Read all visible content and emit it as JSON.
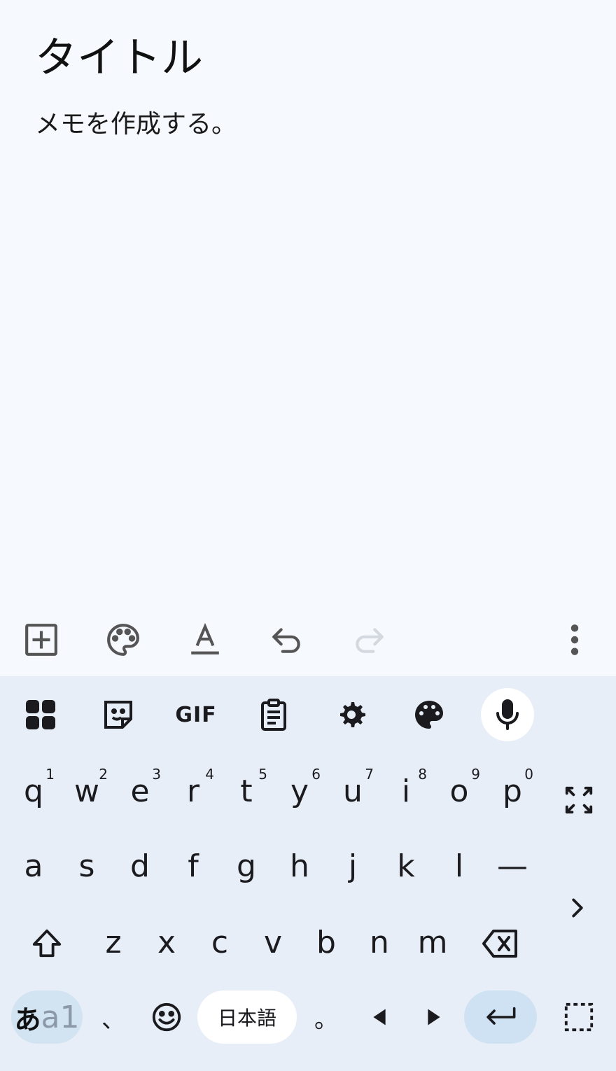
{
  "note": {
    "title": "タイトル",
    "body": "メモを作成する。"
  },
  "note_toolbar": {
    "icons": [
      "add-box-icon",
      "palette-icon",
      "text-format-icon",
      "undo-icon",
      "redo-icon",
      "more-vert-icon"
    ]
  },
  "keyboard": {
    "toolbar_icons": [
      "apps-grid-icon",
      "sticker-icon",
      "gif-icon",
      "clipboard-icon",
      "settings-icon",
      "theme-palette-icon",
      "mic-icon"
    ],
    "gif_label": "GIF",
    "row1": [
      {
        "key": "q",
        "hint": "1"
      },
      {
        "key": "w",
        "hint": "2"
      },
      {
        "key": "e",
        "hint": "3"
      },
      {
        "key": "r",
        "hint": "4"
      },
      {
        "key": "t",
        "hint": "5"
      },
      {
        "key": "y",
        "hint": "6"
      },
      {
        "key": "u",
        "hint": "7"
      },
      {
        "key": "i",
        "hint": "8"
      },
      {
        "key": "o",
        "hint": "9"
      },
      {
        "key": "p",
        "hint": "0"
      }
    ],
    "row2": [
      "a",
      "s",
      "d",
      "f",
      "g",
      "h",
      "j",
      "k",
      "l",
      "—"
    ],
    "row3": [
      "z",
      "x",
      "c",
      "v",
      "b",
      "n",
      "m"
    ],
    "bottom": {
      "mode_a": "あ",
      "mode_b": "a1",
      "comma": "、",
      "space_label": "日本語",
      "period": "。"
    }
  }
}
